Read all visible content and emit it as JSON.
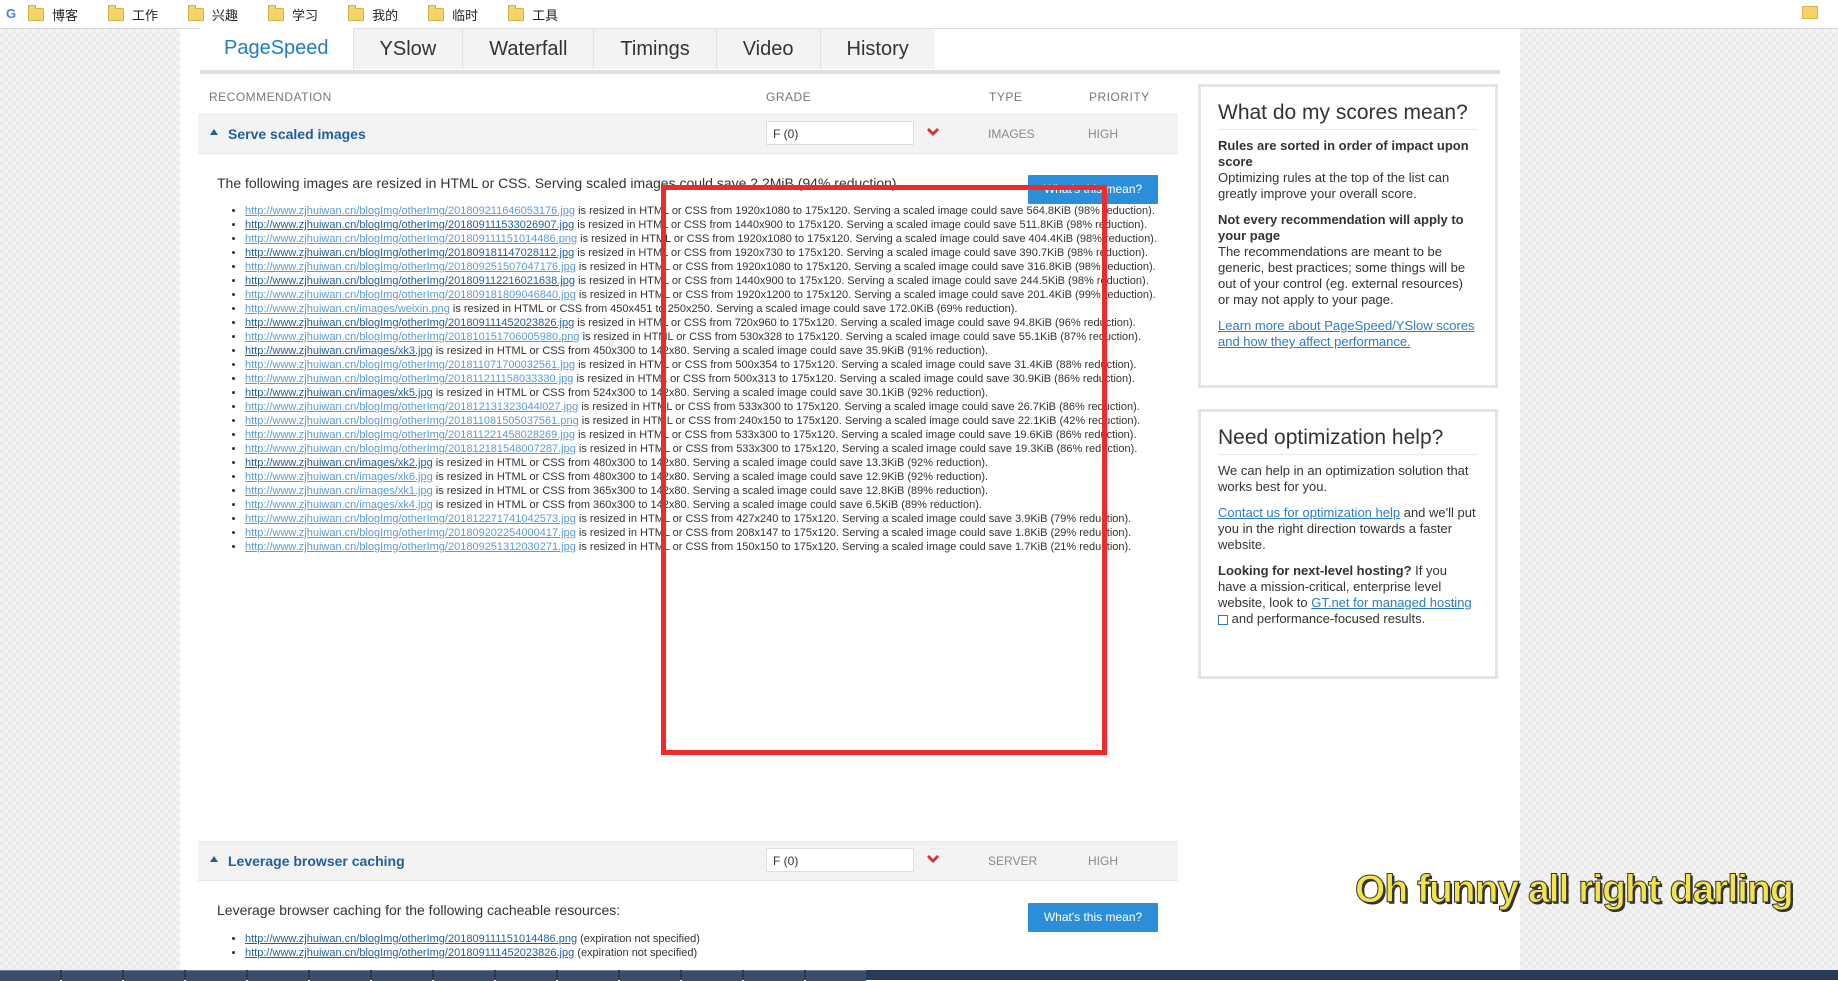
{
  "bookmarks": [
    "博客",
    "工作",
    "兴趣",
    "学习",
    "我的",
    "临时",
    "工具"
  ],
  "tabs": [
    "PageSpeed",
    "YSlow",
    "Waterfall",
    "Timings",
    "Video",
    "History"
  ],
  "headers": {
    "recommendation": "RECOMMENDATION",
    "grade": "GRADE",
    "type": "TYPE",
    "priority": "PRIORITY"
  },
  "rec1": {
    "title": "Serve scaled images",
    "grade": "F (0)",
    "type": "IMAGES",
    "priority": "HIGH",
    "desc": "The following images are resized in HTML or CSS. Serving scaled images could save 2.2MiB (94% reduction).",
    "button": "What's this mean?",
    "items": [
      {
        "url": "http://www.zjhuiwan.cn/blogImg/otherImg/201809211646053176.jpg",
        "text": " is resized in HTML or CSS from 1920x1080 to 175x120. Serving a scaled image could save 564.8KiB (98% reduction)."
      },
      {
        "url": "http://www.zjhuiwan.cn/blogImg/otherImg/201809111533026907.jpg",
        "text": " is resized in HTML or CSS from 1440x900 to 175x120. Serving a scaled image could save 511.8KiB (98% reduction)."
      },
      {
        "url": "http://www.zjhuiwan.cn/blogImg/otherImg/201809111151014486.png",
        "text": " is resized in HTML or CSS from 1920x1080 to 175x120. Serving a scaled image could save 404.4KiB (98% reduction)."
      },
      {
        "url": "http://www.zjhuiwan.cn/blogImg/otherImg/201809181147028112.jpg",
        "text": " is resized in HTML or CSS from 1920x730 to 175x120. Serving a scaled image could save 390.7KiB (98% reduction)."
      },
      {
        "url": "http://www.zjhuiwan.cn/blogImg/otherImg/201809251507047176.jpg",
        "text": " is resized in HTML or CSS from 1920x1080 to 175x120. Serving a scaled image could save 316.8KiB (98% reduction)."
      },
      {
        "url": "http://www.zjhuiwan.cn/blogImg/otherImg/201809112216021638.jpg",
        "text": " is resized in HTML or CSS from 1440x900 to 175x120. Serving a scaled image could save 244.5KiB (98% reduction)."
      },
      {
        "url": "http://www.zjhuiwan.cn/blogImg/otherImg/201809181809046840.jpg",
        "text": " is resized in HTML or CSS from 1920x1200 to 175x120. Serving a scaled image could save 201.4KiB (99% reduction)."
      },
      {
        "url": "http://www.zjhuiwan.cn/images/weixin.png",
        "text": " is resized in HTML or CSS from 450x451 to 250x250. Serving a scaled image could save 172.0KiB (69% reduction)."
      },
      {
        "url": "http://www.zjhuiwan.cn/blogImg/otherImg/201809111452023826.jpg",
        "text": " is resized in HTML or CSS from 720x960 to 175x120. Serving a scaled image could save 94.8KiB (96% reduction)."
      },
      {
        "url": "http://www.zjhuiwan.cn/blogImg/otherImg/201810151706005980.png",
        "text": " is resized in HTML or CSS from 530x328 to 175x120. Serving a scaled image could save 55.1KiB (87% reduction)."
      },
      {
        "url": "http://www.zjhuiwan.cn/images/xk3.jpg",
        "text": " is resized in HTML or CSS from 450x300 to 142x80. Serving a scaled image could save 35.9KiB (91% reduction)."
      },
      {
        "url": "http://www.zjhuiwan.cn/blogImg/otherImg/201811071700032561.jpg",
        "text": " is resized in HTML or CSS from 500x354 to 175x120. Serving a scaled image could save 31.4KiB (88% reduction)."
      },
      {
        "url": "http://www.zjhuiwan.cn/blogImg/otherImg/201811211158033330.jpg",
        "text": " is resized in HTML or CSS from 500x313 to 175x120. Serving a scaled image could save 30.9KiB (86% reduction)."
      },
      {
        "url": "http://www.zjhuiwan.cn/images/xk5.jpg",
        "text": " is resized in HTML or CSS from 524x300 to 142x80. Serving a scaled image could save 30.1KiB (92% reduction)."
      },
      {
        "url": "http://www.zjhuiwan.cn/blogImg/otherImg/201812131323044l027.jpg",
        "text": " is resized in HTML or CSS from 533x300 to 175x120. Serving a scaled image could save 26.7KiB (86% reduction)."
      },
      {
        "url": "http://www.zjhuiwan.cn/blogImg/otherImg/201811081505037561.png",
        "text": " is resized in HTML or CSS from 240x150 to 175x120. Serving a scaled image could save 22.1KiB (42% reduction)."
      },
      {
        "url": "http://www.zjhuiwan.cn/blogImg/otherImg/201811221458028269.jpg",
        "text": " is resized in HTML or CSS from 533x300 to 175x120. Serving a scaled image could save 19.6KiB (86% reduction)."
      },
      {
        "url": "http://www.zjhuiwan.cn/blogImg/otherImg/201812181548007287.jpg",
        "text": " is resized in HTML or CSS from 533x300 to 175x120. Serving a scaled image could save 19.3KiB (86% reduction)."
      },
      {
        "url": "http://www.zjhuiwan.cn/images/xk2.jpg",
        "text": " is resized in HTML or CSS from 480x300 to 142x80. Serving a scaled image could save 13.3KiB (92% reduction)."
      },
      {
        "url": "http://www.zjhuiwan.cn/images/xk6.jpg",
        "text": " is resized in HTML or CSS from 480x300 to 142x80. Serving a scaled image could save 12.9KiB (92% reduction)."
      },
      {
        "url": "http://www.zjhuiwan.cn/images/xk1.jpg",
        "text": " is resized in HTML or CSS from 365x300 to 142x80. Serving a scaled image could save 12.8KiB (89% reduction)."
      },
      {
        "url": "http://www.zjhuiwan.cn/images/xk4.jpg",
        "text": " is resized in HTML or CSS from 360x300 to 142x80. Serving a scaled image could save 6.5KiB (89% reduction)."
      },
      {
        "url": "http://www.zjhuiwan.cn/blogImg/otherImg/201812271741042573.jpg",
        "text": " is resized in HTML or CSS from 427x240 to 175x120. Serving a scaled image could save 3.9KiB (79% reduction)."
      },
      {
        "url": "http://www.zjhuiwan.cn/blogImg/otherImg/201809202254000417.jpg",
        "text": " is resized in HTML or CSS from 208x147 to 175x120. Serving a scaled image could save 1.8KiB (29% reduction)."
      },
      {
        "url": "http://www.zjhuiwan.cn/blogImg/otherImg/201809251312030271.jpg",
        "text": " is resized in HTML or CSS from 150x150 to 175x120. Serving a scaled image could save 1.7KiB (21% reduction)."
      }
    ]
  },
  "rec2": {
    "title": "Leverage browser caching",
    "grade": "F (0)",
    "type": "SERVER",
    "priority": "HIGH",
    "desc": "Leverage browser caching for the following cacheable resources:",
    "button": "What's this mean?",
    "items": [
      {
        "url": "http://www.zjhuiwan.cn/blogImg/otherImg/201809111151014486.png",
        "text": " (expiration not specified)"
      },
      {
        "url": "http://www.zjhuiwan.cn/blogImg/otherImg/201809111452023826.jpg",
        "text": " (expiration not specified)"
      }
    ]
  },
  "panel1": {
    "title": "What do my scores mean?",
    "b1": "Rules are sorted in order of impact upon score",
    "t1": "Optimizing rules at the top of the list can greatly improve your overall score.",
    "b2": "Not every recommendation will apply to your page",
    "t2": "The recommendations are meant to be generic, best practices; some things will be out of your control (eg. external resources) or may not apply to your page.",
    "link": "Learn more about PageSpeed/YSlow scores and how they affect performance."
  },
  "panel2": {
    "title": "Need optimization help?",
    "t1": "We can help in an optimization solution that works best for you.",
    "link1": "Contact us for optimization help",
    "t2": " and we'll put you in the right direction towards a faster website.",
    "b3": "Looking for next-level hosting?",
    "t3": " If you have a mission-critical, enterprise level website, look to ",
    "link2": "GT.net for managed hosting",
    "t4": " and performance-focused results."
  },
  "subtitle": "Oh funny all right darling"
}
